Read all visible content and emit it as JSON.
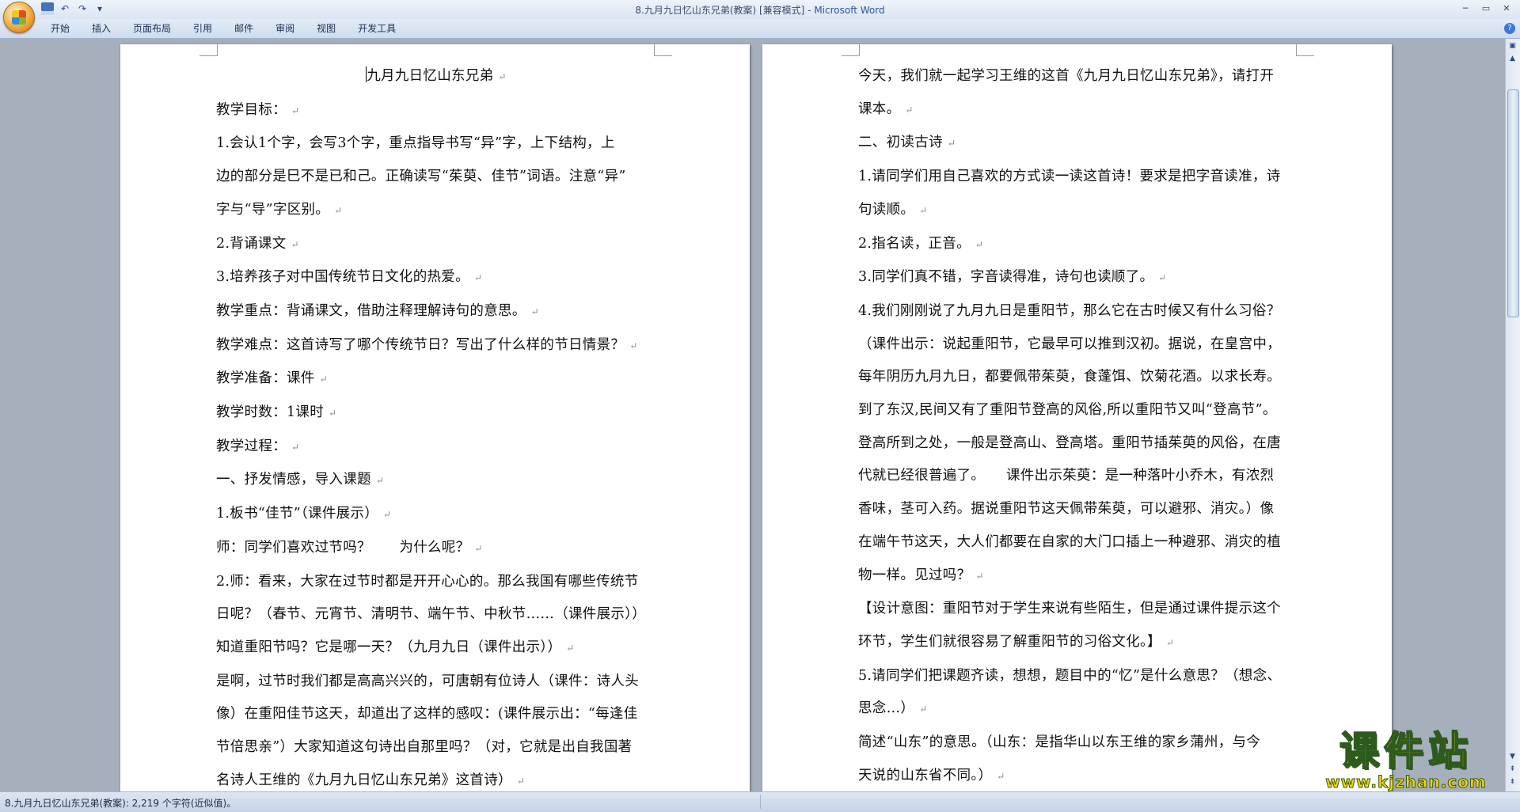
{
  "window": {
    "title": "8.九月九日忆山东兄弟(教案) [兼容模式] - ",
    "app_name": "Microsoft Word"
  },
  "quick_access": {
    "save_icon": "save-icon",
    "undo_icon": "undo-icon",
    "redo_icon": "redo-icon",
    "customize_icon": "dropdown-icon"
  },
  "ribbon": {
    "tabs": [
      "开始",
      "插入",
      "页面布局",
      "引用",
      "邮件",
      "审阅",
      "视图",
      "开发工具"
    ]
  },
  "left_page": {
    "title": "九月九日忆山东兄弟",
    "paragraphs": [
      "教学目标：",
      "1.会认1个字，会写3个字，重点指导书写“异”字，上下结构，上",
      "边的部分是巳不是已和己。正确读写“茱萸、佳节”词语。注意“异”",
      "字与“导”字区别。",
      "2.背诵课文",
      "3.培养孩子对中国传统节日文化的热爱。",
      "教学重点：背诵课文，借助注释理解诗句的意思。",
      "教学难点：这首诗写了哪个传统节日？写出了什么样的节日情景？",
      "教学准备：课件",
      "教学时数：1课时",
      "教学过程：",
      "一、抒发情感，导入课题",
      "1.板书“佳节”（课件展示）",
      "师：同学们喜欢过节吗？　　为什么呢？",
      "2.师：看来，大家在过节时都是开开心心的。那么我国有哪些传统节",
      "日呢？（春节、元宵节、清明节、端午节、中秋节……（课件展示））",
      "知道重阳节吗？它是哪一天？（九月九日（课件出示））",
      "是啊，过节时我们都是高高兴兴的，可唐朝有位诗人（课件：诗人头",
      "像）在重阳佳节这天，却道出了这样的感叹：(课件展示出：“每逢佳",
      "节倍思亲”）大家知道这句诗出自那里吗？（对，它就是出自我国著",
      "名诗人王维的《九月九日忆山东兄弟》这首诗）"
    ]
  },
  "right_page": {
    "paragraphs": [
      "今天，我们就一起学习王维的这首《九月九日忆山东兄弟》，请打开",
      "课本。",
      "二、初读古诗",
      "1.请同学们用自己喜欢的方式读一读这首诗！要求是把字音读准，诗",
      "句读顺。",
      "2.指名读，正音。",
      "3.同学们真不错，字音读得准，诗句也读顺了。",
      "4.我们刚刚说了九月九日是重阳节，那么它在古时候又有什么习俗？",
      "（课件出示：说起重阳节，它最早可以推到汉初。据说，在皇宫中，",
      "每年阴历九月九日，都要佩带茱萸，食蓬饵、饮菊花酒。以求长寿。",
      "到了东汉,民间又有了重阳节登高的风俗,所以重阳节又叫“登高节”。",
      "登高所到之处，一般是登高山、登高塔。重阳节插茱萸的风俗，在唐",
      "代就已经很普遍了。　　课件出示茱萸：是一种落叶小乔木，有浓烈",
      "香味，茎可入药。据说重阳节这天佩带茱萸，可以避邪、消灾。）像",
      "在端午节这天，大人们都要在自家的大门口插上一种避邪、消灾的植",
      "物一样。见过吗？",
      "【设计意图：重阳节对于学生来说有些陌生，但是通过课件提示这个",
      "环节，学生们就很容易了解重阳节的习俗文化。】",
      "5.请同学们把课题齐读，想想，题目中的“忆”是什么意思？（想念、",
      "思念…）",
      "简述“山东”的意思。（山东：是指华山以东王维的家乡蒲州，与今",
      "天说的山东省不同。）"
    ]
  },
  "status_bar": {
    "text": "8.九月九日忆山东兄弟(教案): 2,219 个字符(近似值)。"
  },
  "watermark": {
    "title": "课件站",
    "url": "www.kjzhan.com"
  },
  "colors": {
    "accent": "#2f5597",
    "workspace": "#a6afbc",
    "watermark": "#ffd400"
  }
}
